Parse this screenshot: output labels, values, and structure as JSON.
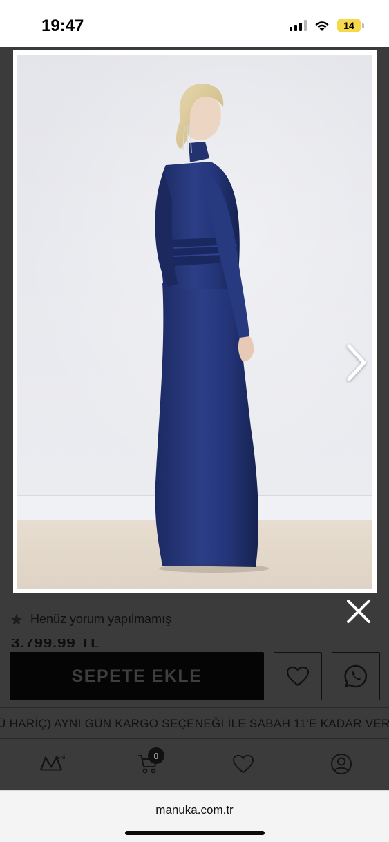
{
  "status_bar": {
    "time": "19:47",
    "battery_level": "14",
    "icons": [
      "cellular-signal-icon",
      "wifi-icon",
      "battery-icon"
    ]
  },
  "lightbox": {
    "image_alt": "Model in long navy satin dress, back view",
    "next_icon": "chevron-right-icon",
    "close_icon": "close-icon"
  },
  "product": {
    "review_text": "Henüz yorum yapılmamış",
    "price_partial": "3.799,99 TL",
    "add_to_cart_label": "SEPETE EKLE",
    "wishlist_icon": "heart-icon",
    "whatsapp_icon": "whatsapp-icon"
  },
  "announcement": {
    "text": "Ü HARİÇ) AYNI GÜN KARGO SEÇENEĞİ İLE SABAH 11'E KADAR VER"
  },
  "bottom_nav": {
    "logo_text": "YENİ",
    "cart_count": "0",
    "icons": [
      "brand-logo-icon",
      "cart-icon",
      "heart-icon",
      "account-icon"
    ]
  },
  "browser": {
    "url": "manuka.com.tr"
  },
  "colors": {
    "dress": "#23326e",
    "overlay": "#3b3b3b",
    "button_bg": "#050505"
  }
}
